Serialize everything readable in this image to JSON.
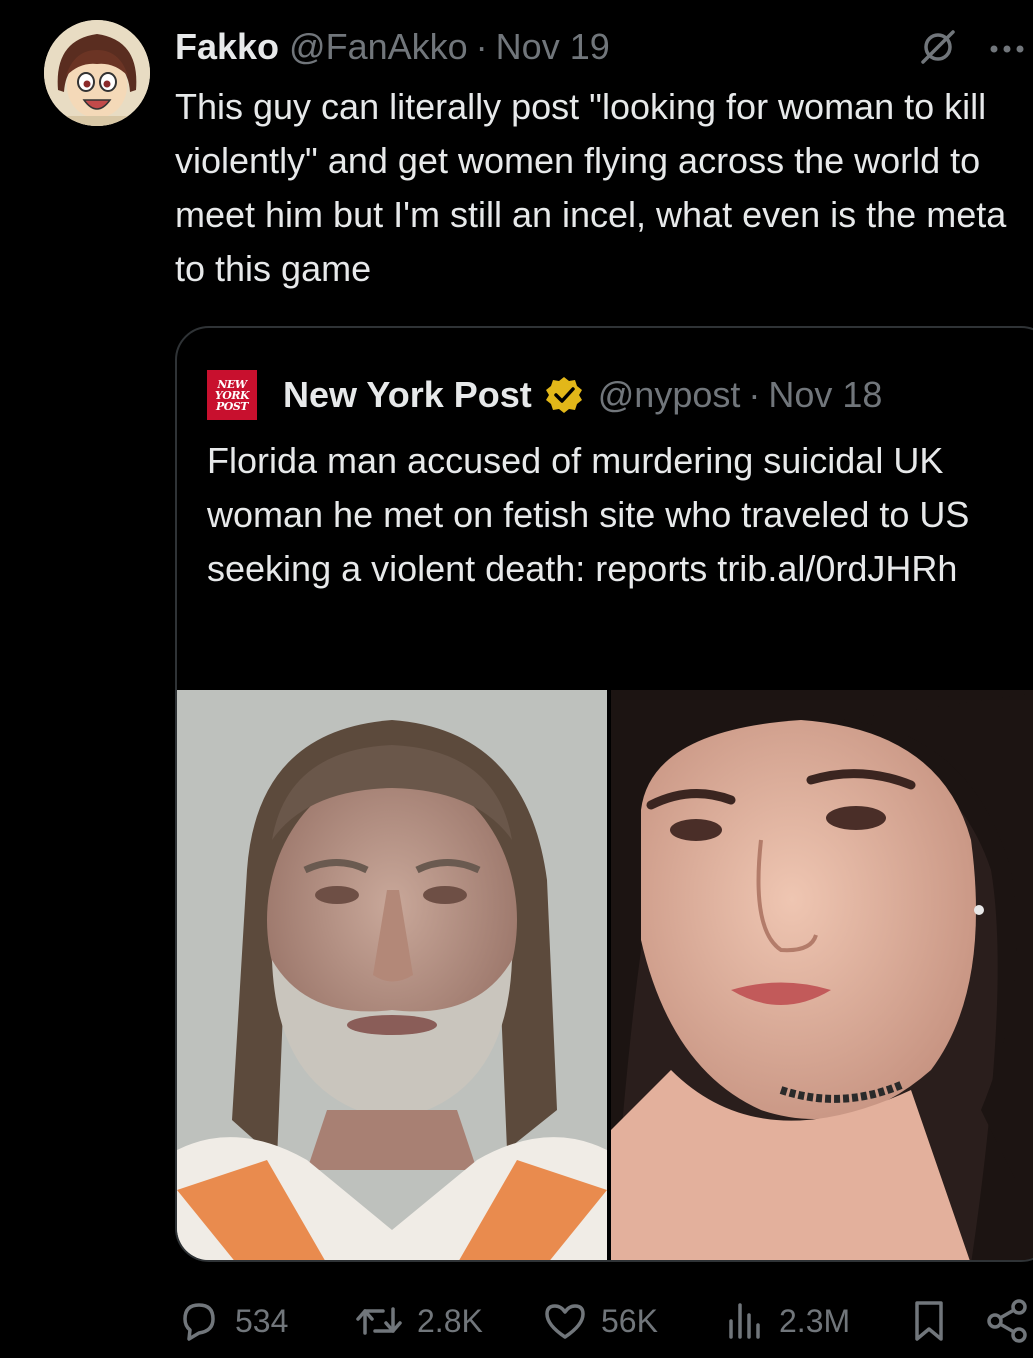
{
  "tweet": {
    "author": {
      "display_name": "Fakko",
      "handle": "@FanAkko",
      "separator": "·",
      "date": "Nov 19",
      "avatar_icon": "anime-girl-avatar"
    },
    "text": "This guy can literally post \"looking for woman to kill violently\" and get women flying across the world to meet him but I'm still an incel, what even is the meta to this game",
    "header_icons": [
      "grok-icon",
      "more-icon"
    ]
  },
  "quote": {
    "author": {
      "logo_lines": [
        "NEW",
        "YORK",
        "POST"
      ],
      "display_name": "New York Post",
      "verified_color": "#e2b719",
      "handle": "@nypost",
      "separator": "·",
      "date": "Nov 18"
    },
    "text": "Florida man accused of murdering suicidal UK woman he met on fetish site who traveled to US seeking a violent death: reports trib.al/0rdJHRh",
    "images": [
      "mugshot-photo",
      "woman-portrait-photo"
    ]
  },
  "actions": {
    "replies": "534",
    "reposts": "2.8K",
    "likes": "56K",
    "views": "2.3M"
  },
  "colors": {
    "background": "#000000",
    "text": "#e7e9ea",
    "muted": "#71767b",
    "border": "#2f3336",
    "nyp_red": "#c8102e"
  }
}
